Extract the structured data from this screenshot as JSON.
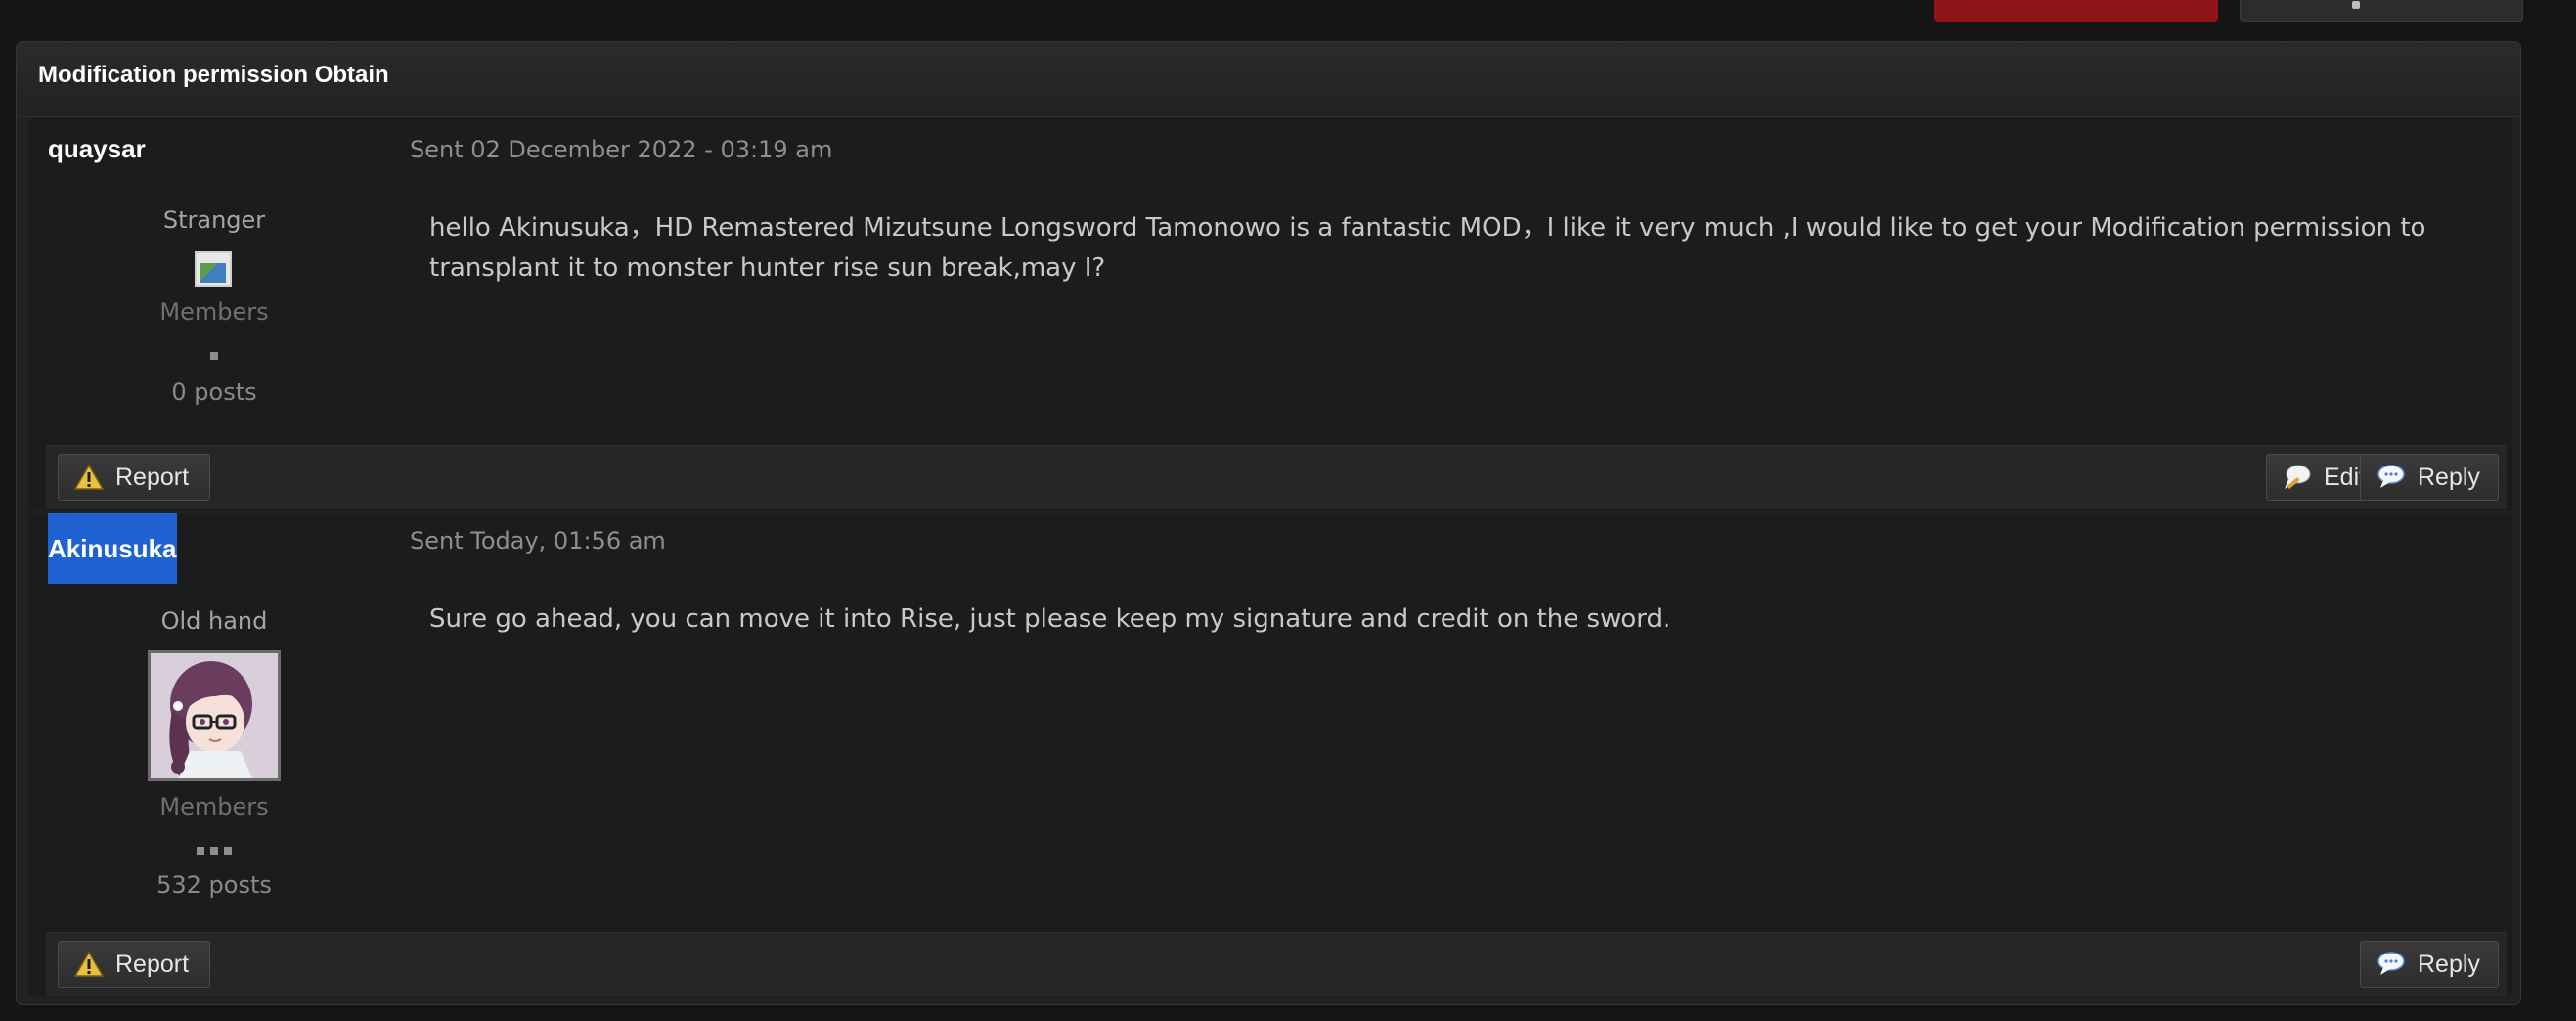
{
  "thread": {
    "title": "Modification permission Obtain"
  },
  "posts": [
    {
      "author": "quaysar",
      "rank": "Stranger",
      "group": "Members",
      "post_count": "0 posts",
      "date": "Sent 02 December 2022 - 03:19 am",
      "body": "hello Akinusuka，HD Remastered Mizutsune Longsword Tamonowo is a fantastic MOD，I like it very much ,I would like to get your Modification permission to transplant it to monster hunter rise sun break,may I?",
      "actions": {
        "report": "Report",
        "edit": "Edit",
        "reply": "Reply"
      }
    },
    {
      "author": "Akinusuka",
      "rank": "Old hand",
      "group": "Members",
      "post_count": "532 posts",
      "date": "Sent Today, 01:56 am",
      "body": "Sure go ahead, you can move it into Rise, just please keep my signature and credit on the sword.",
      "actions": {
        "report": "Report",
        "reply": "Reply"
      }
    }
  ],
  "colors": {
    "accent_red": "#8f1419",
    "selection_blue": "#1e63d1",
    "background": "#151515"
  },
  "icons": {
    "report": "warning-triangle-icon",
    "edit": "speech-bubble-pencil-icon",
    "reply": "speech-bubble-icon"
  }
}
